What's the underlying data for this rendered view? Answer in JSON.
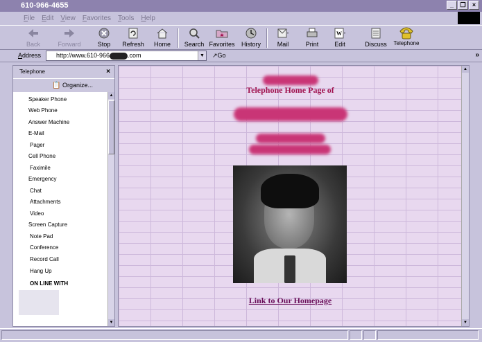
{
  "window": {
    "title": "610-966-4655"
  },
  "window_controls": {
    "minimize": "_",
    "restore": "❐",
    "close": "×"
  },
  "menu": [
    "File",
    "Edit",
    "View",
    "Favorites",
    "Tools",
    "Help"
  ],
  "toolbar": {
    "back": "Back",
    "forward": "Forward",
    "stop": "Stop",
    "refresh": "Refresh",
    "home": "Home",
    "search": "Search",
    "favorites": "Favorites",
    "history": "History",
    "mail": "Mail",
    "print": "Print",
    "edit": "Edit",
    "discuss": "Discuss",
    "telephone": "Telephone"
  },
  "address": {
    "label": "Address",
    "url_prefix": "http://www.610-966",
    "url_suffix": ".com",
    "go": "Go",
    "more": "»"
  },
  "sidebar": {
    "title": "Telephone",
    "close": "×",
    "organize": "Organize...",
    "items": [
      "Speaker Phone",
      "Web Phone",
      "Answer Machine",
      "E-Mail",
      "Pager",
      "Cell Phone",
      "Faximile",
      "Emergency",
      "Chat",
      "Attachments",
      "Video",
      "Screen Capture",
      "Note Pad",
      "Conference",
      "Record Call",
      "Hang Up"
    ],
    "online": "ON LINE WITH"
  },
  "content": {
    "heading": "Telephone Home Page of",
    "link": "Link to Our Homepage"
  }
}
